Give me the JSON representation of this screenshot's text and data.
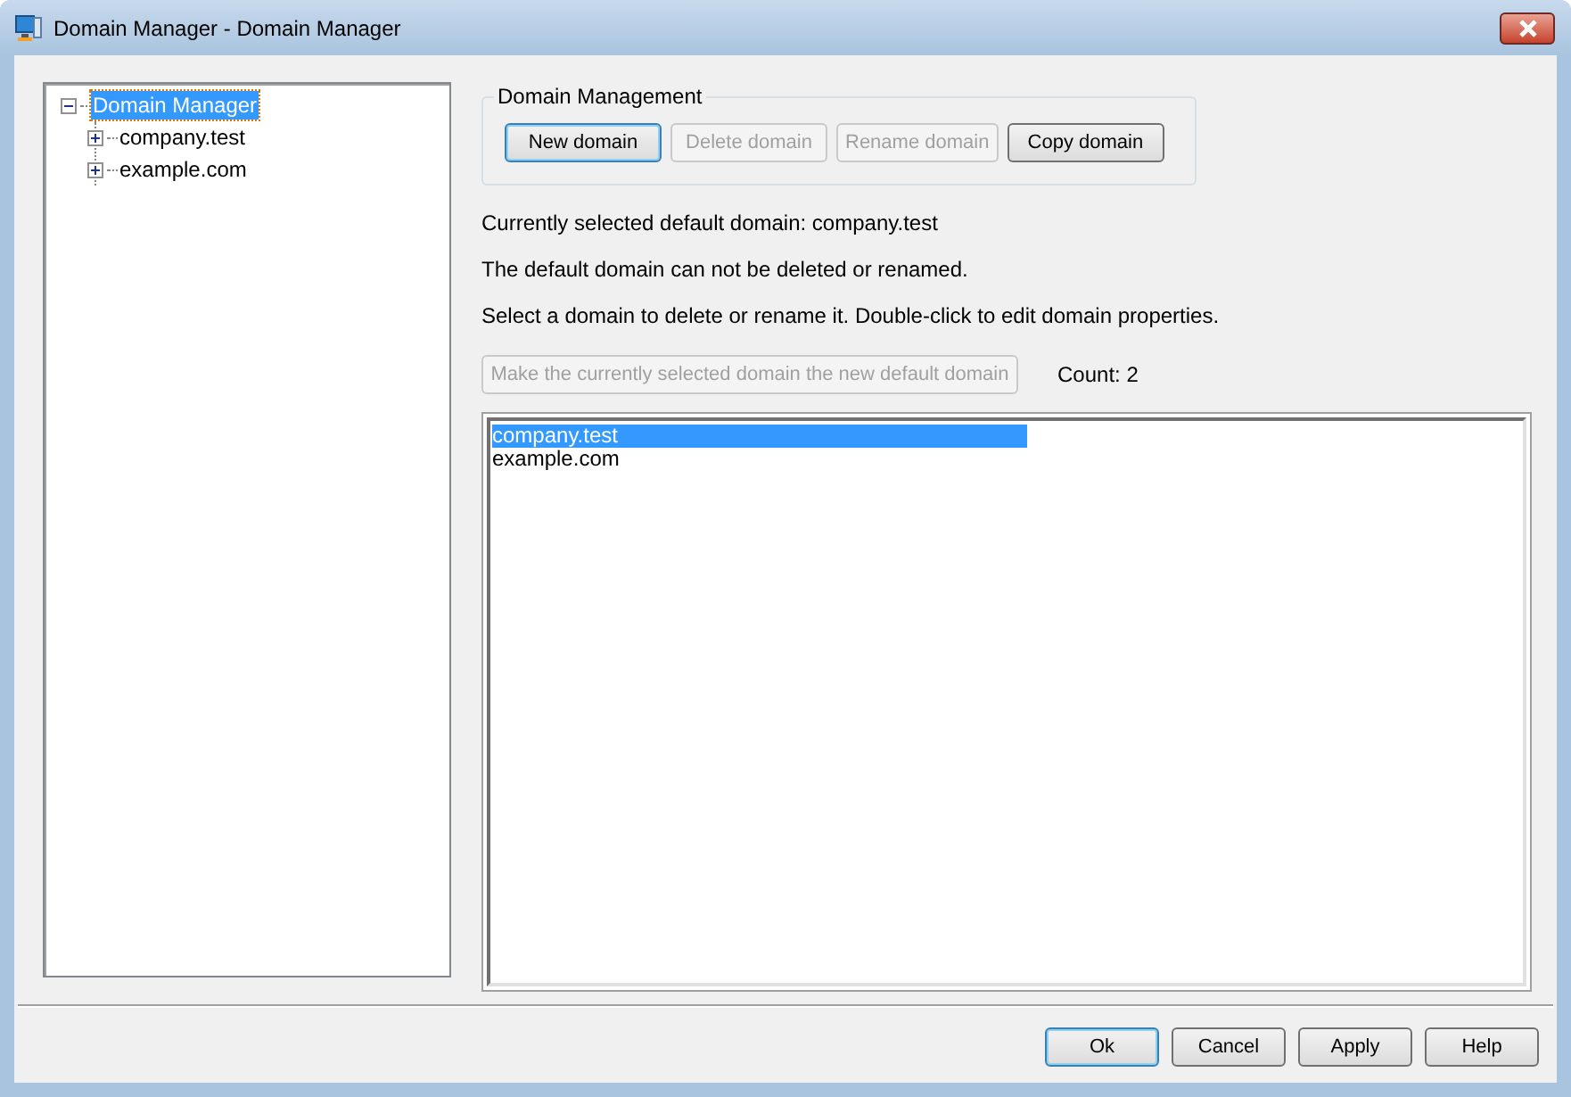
{
  "window": {
    "title": "Domain Manager - Domain Manager"
  },
  "tree": [
    {
      "label": "Domain Manager",
      "selected": true,
      "expanded": true,
      "children": [
        {
          "label": "company.test",
          "selected": false,
          "expanded": false
        },
        {
          "label": "example.com",
          "selected": false,
          "expanded": false
        }
      ]
    }
  ],
  "domain_management": {
    "title": "Domain Management",
    "buttons": [
      {
        "label": "New domain",
        "disabled": false,
        "default": true
      },
      {
        "label": "Delete domain",
        "disabled": true
      },
      {
        "label": "Rename domain",
        "disabled": true
      },
      {
        "label": "Copy domain",
        "disabled": false,
        "default": false
      }
    ]
  },
  "info": [
    "Currently selected default domain: company.test",
    "The default domain can not be deleted or renamed.",
    "Select a domain to delete or rename it.  Double-click to edit domain properties."
  ],
  "make_default_button": {
    "label": "Make the currently selected domain the new default domain",
    "disabled": true
  },
  "count": "Count: 2",
  "domain_list": [
    {
      "label": "company.test",
      "selected": true
    },
    {
      "label": "example.com",
      "selected": false
    }
  ],
  "dialog_buttons": [
    {
      "label": "Ok",
      "default": true
    },
    {
      "label": "Cancel",
      "default": false
    },
    {
      "label": "Apply",
      "default": false
    },
    {
      "label": "Help",
      "default": false
    }
  ]
}
